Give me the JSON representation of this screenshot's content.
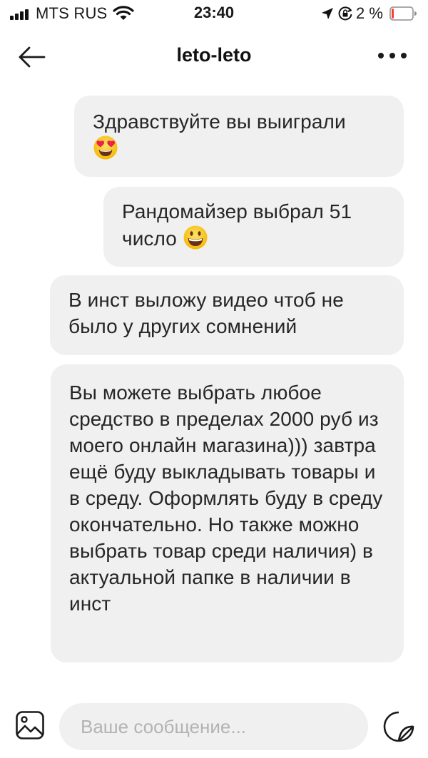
{
  "status_bar": {
    "carrier": "MTS RUS",
    "time": "23:40",
    "battery_percent": "2 %",
    "battery_level": 0.02,
    "battery_color": "#ff3b30",
    "icons": [
      "signal-bars-icon",
      "wifi-icon",
      "location-arrow-icon",
      "orientation-lock-icon",
      "battery-icon"
    ]
  },
  "header": {
    "title": "leto-leto",
    "back_icon": "arrow-left-icon",
    "more_icon": "more-horizontal-icon"
  },
  "messages": [
    {
      "text": "Здравствуйте вы выиграли",
      "emoji": "heart-eyes-emoji"
    },
    {
      "text": "Рандомайзер выбрал 51 число",
      "emoji": "grinning-face-emoji"
    },
    {
      "text": "В инст выложу видео чтоб не было у других сомнений"
    },
    {
      "text": "Вы можете выбрать любое средство в пределах 2000 руб из моего онлайн магазина))) завтра ещё буду выкладывать товары и в среду. Оформлять буду в среду окончательно. Но также можно выбрать товар среди наличия) в актуальной папке в наличии в инст"
    }
  ],
  "composer": {
    "placeholder": "Ваше сообщение...",
    "value": "",
    "gallery_icon": "image-gallery-icon",
    "sticker_icon": "sticker-icon"
  },
  "colors": {
    "bubble_bg": "#f0f0f0",
    "text": "#262626",
    "placeholder": "#b3b3b3",
    "background": "#ffffff"
  }
}
